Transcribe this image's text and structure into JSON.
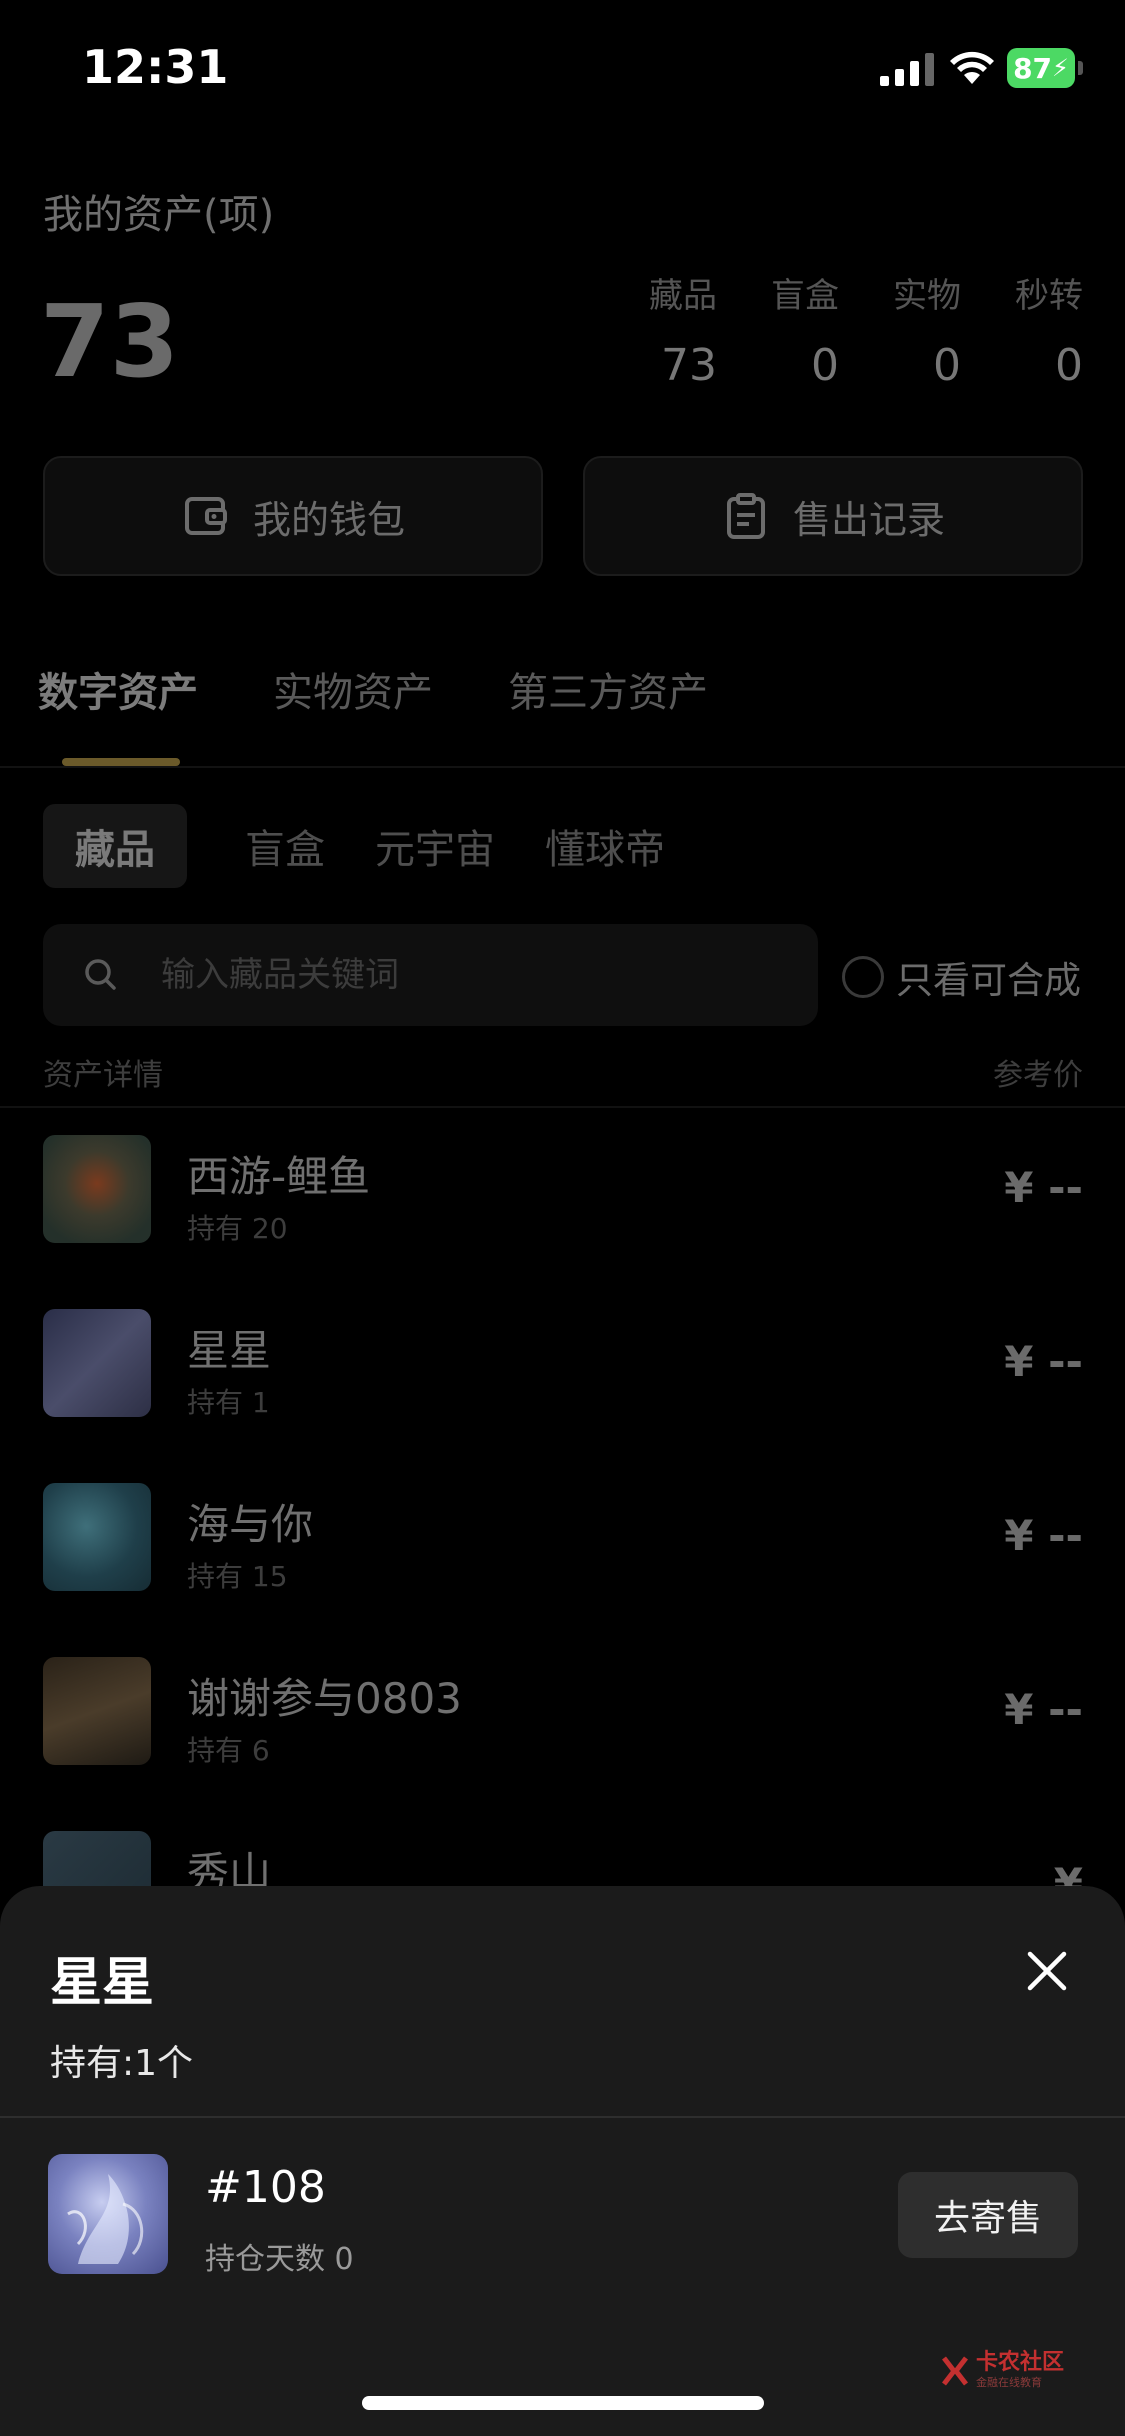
{
  "status_bar": {
    "time": "12:31",
    "battery": "87"
  },
  "assets": {
    "title": "我的资产(项)",
    "total": "73",
    "stats": [
      {
        "label": "藏品",
        "value": "73"
      },
      {
        "label": "盲盒",
        "value": "0"
      },
      {
        "label": "实物",
        "value": "0"
      },
      {
        "label": "秒转",
        "value": "0"
      }
    ]
  },
  "buttons": {
    "wallet": "我的钱包",
    "sales": "售出记录"
  },
  "main_tabs": [
    "数字资产",
    "实物资产",
    "第三方资产"
  ],
  "sub_tabs": [
    "藏品",
    "盲盒",
    "元宇宙",
    "懂球帝"
  ],
  "search": {
    "placeholder": "输入藏品关键词",
    "only_compose": "只看可合成"
  },
  "list_header": {
    "left": "资产详情",
    "right": "参考价"
  },
  "items": [
    {
      "name": "西游-鲤鱼",
      "hold": "持有 20",
      "price": "¥ --"
    },
    {
      "name": "星星",
      "hold": "持有 1",
      "price": "¥ --"
    },
    {
      "name": "海与你",
      "hold": "持有 15",
      "price": "¥ --"
    },
    {
      "name": "谢谢参与0803",
      "hold": "持有 6",
      "price": "¥ --"
    },
    {
      "name": "秀山",
      "hold": "",
      "price": "¥"
    }
  ],
  "sheet": {
    "title": "星星",
    "hold": "持有:1个",
    "item_number": "#108",
    "item_days": "持仓天数 0",
    "consign": "去寄售"
  },
  "watermark": {
    "text": "卡农社区",
    "sub": "金融在线教育"
  },
  "colors": {
    "background": "#000000",
    "sheet": "#1b1b1b",
    "indicator": "#6b5a2a",
    "battery": "#4cd964"
  }
}
